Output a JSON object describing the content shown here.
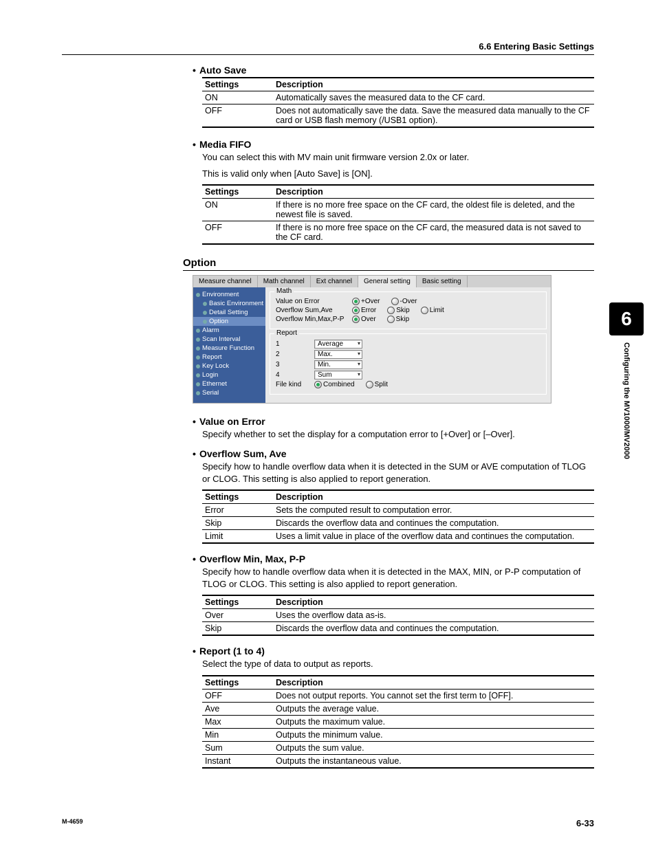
{
  "header": "6.6  Entering Basic Settings",
  "autoSave": {
    "title": "Auto Save",
    "col1": "Settings",
    "col2": "Description",
    "rows": [
      {
        "s": "ON",
        "d": "Automatically saves the measured data to the CF card."
      },
      {
        "s": "OFF",
        "d": "Does not automatically save the data. Save the measured data manually to the CF card or USB flash memory (/USB1 option)."
      }
    ]
  },
  "mediaFifo": {
    "title": "Media FIFO",
    "p1": "You can select this with MV main unit firmware version 2.0x or later.",
    "p2": "This is valid only when [Auto Save] is [ON].",
    "col1": "Settings",
    "col2": "Description",
    "rows": [
      {
        "s": "ON",
        "d": "If there is no more free space on the CF card, the oldest file is deleted, and the newest file is saved."
      },
      {
        "s": "OFF",
        "d": "If there is no more free space on the CF card, the measured data is not saved to the CF card."
      }
    ]
  },
  "optionTitle": "Option",
  "ui": {
    "tabs": [
      "Measure channel",
      "Math channel",
      "Ext channel",
      "General setting",
      "Basic setting"
    ],
    "side": [
      "Environment",
      "Basic Environment",
      "Detail Setting",
      "Option",
      "Alarm",
      "Scan Interval",
      "Measure Function",
      "Report",
      "Key Lock",
      "Login",
      "Ethernet",
      "Serial"
    ],
    "math": {
      "title": "Math",
      "valueOnError": "Value on Error",
      "radios1": [
        "+Over",
        "-Over"
      ],
      "overflowSum": "Overflow Sum,Ave",
      "radios2": [
        "Error",
        "Skip",
        "Limit"
      ],
      "overflowMin": "Overflow Min,Max,P-P",
      "radios3": [
        "Over",
        "Skip"
      ]
    },
    "report": {
      "title": "Report",
      "rows": [
        {
          "n": "1",
          "v": "Average"
        },
        {
          "n": "2",
          "v": "Max."
        },
        {
          "n": "3",
          "v": "Min."
        },
        {
          "n": "4",
          "v": "Sum"
        }
      ],
      "fileKind": "File kind",
      "fkradios": [
        "Combined",
        "Split"
      ]
    }
  },
  "valueOnError": {
    "title": "Value on Error",
    "p": "Specify whether to set the display for a computation error to [+Over] or [–Over]."
  },
  "overflowSumAve": {
    "title": "Overflow Sum, Ave",
    "p": "Specify how to handle overflow data when it is detected in the SUM or AVE computation of TLOG or CLOG.  This setting is also applied to report generation.",
    "col1": "Settings",
    "col2": "Description",
    "rows": [
      {
        "s": "Error",
        "d": "Sets the computed result to computation error."
      },
      {
        "s": "Skip",
        "d": "Discards the overflow data and continues the computation."
      },
      {
        "s": "Limit",
        "d": "Uses a limit value in place of the overflow data and continues the computation."
      }
    ]
  },
  "overflowMinMax": {
    "title": "Overflow Min, Max, P-P",
    "p": "Specify how to handle overflow data when it is detected in the MAX, MIN, or P-P computation of TLOG or CLOG.  This setting is also applied to report generation.",
    "col1": "Settings",
    "col2": "Description",
    "rows": [
      {
        "s": "Over",
        "d": "Uses the overflow data as-is."
      },
      {
        "s": "Skip",
        "d": "Discards the overflow data and continues the computation."
      }
    ]
  },
  "report": {
    "title": "Report (1 to 4)",
    "p": "Select the type of data to output as reports.",
    "col1": "Settings",
    "col2": "Description",
    "rows": [
      {
        "s": "OFF",
        "d": "Does not output reports. You cannot set the first term to [OFF]."
      },
      {
        "s": "Ave",
        "d": "Outputs the average value."
      },
      {
        "s": "Max",
        "d": "Outputs the maximum value."
      },
      {
        "s": "Min",
        "d": "Outputs the minimum value."
      },
      {
        "s": "Sum",
        "d": "Outputs the sum value."
      },
      {
        "s": "Instant",
        "d": "Outputs the instantaneous value."
      }
    ]
  },
  "sideTab": {
    "num": "6",
    "text": "Configuring the MV1000/MV2000"
  },
  "footer": {
    "left": "M-4659",
    "right": "6-33"
  }
}
